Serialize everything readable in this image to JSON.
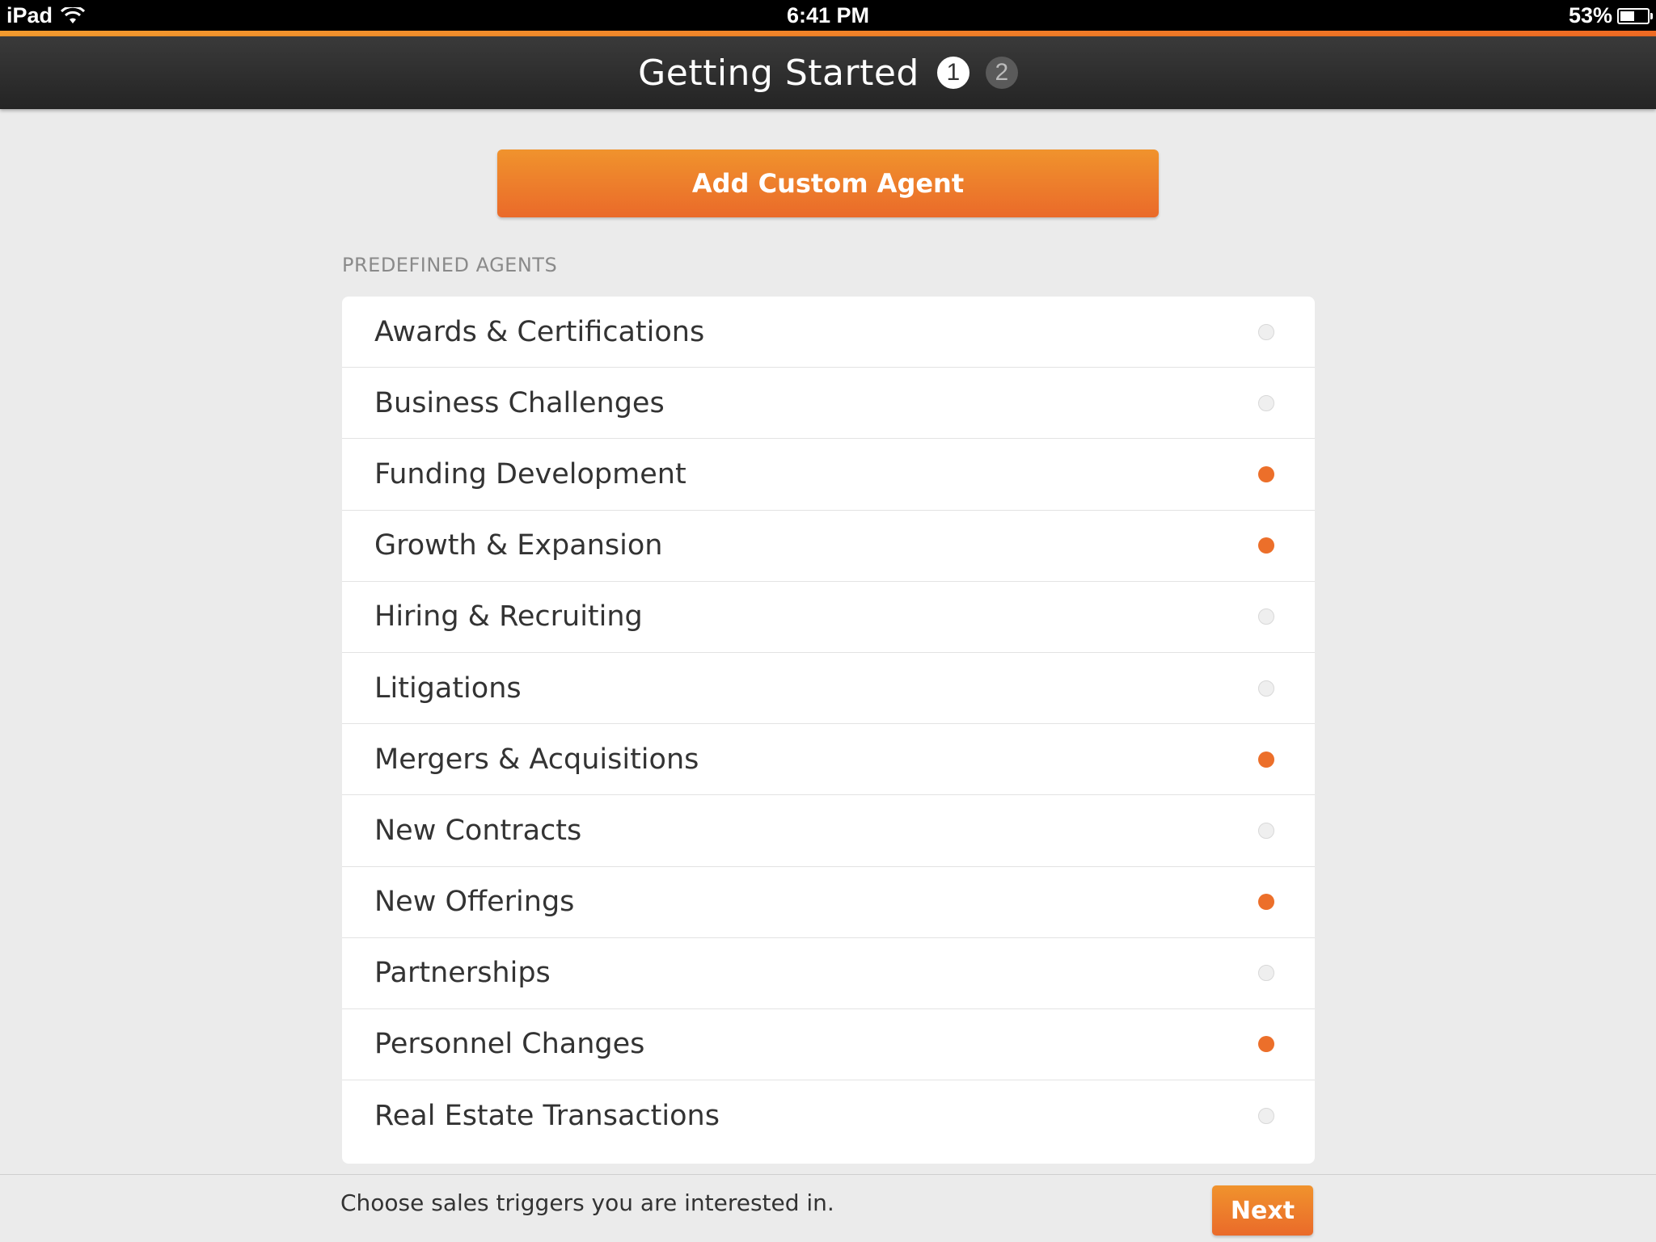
{
  "status_bar": {
    "device": "iPad",
    "time": "6:41 PM",
    "battery": "53%",
    "battery_level": 0.53
  },
  "header": {
    "title": "Getting Started",
    "steps": [
      "1",
      "2"
    ],
    "active_step": "1"
  },
  "add_custom_agent_label": "Add Custom Agent",
  "section_label": "PREDEFINED AGENTS",
  "agents": [
    {
      "label": "Awards & Certifications",
      "selected": false
    },
    {
      "label": "Business Challenges",
      "selected": false
    },
    {
      "label": "Funding Development",
      "selected": true
    },
    {
      "label": "Growth & Expansion",
      "selected": true
    },
    {
      "label": "Hiring & Recruiting",
      "selected": false
    },
    {
      "label": "Litigations",
      "selected": false
    },
    {
      "label": "Mergers & Acquisitions",
      "selected": true
    },
    {
      "label": "New Contracts",
      "selected": false
    },
    {
      "label": "New Offerings",
      "selected": true
    },
    {
      "label": "Partnerships",
      "selected": false
    },
    {
      "label": "Personnel Changes",
      "selected": true
    },
    {
      "label": "Real Estate Transactions",
      "selected": false
    }
  ],
  "footer": {
    "instruction": "Choose sales triggers you are interested in.",
    "next_label": "Next"
  },
  "colors": {
    "accent": "#ec6f2a",
    "nav_dark": "#2e2e2e",
    "background": "#ebebeb"
  }
}
